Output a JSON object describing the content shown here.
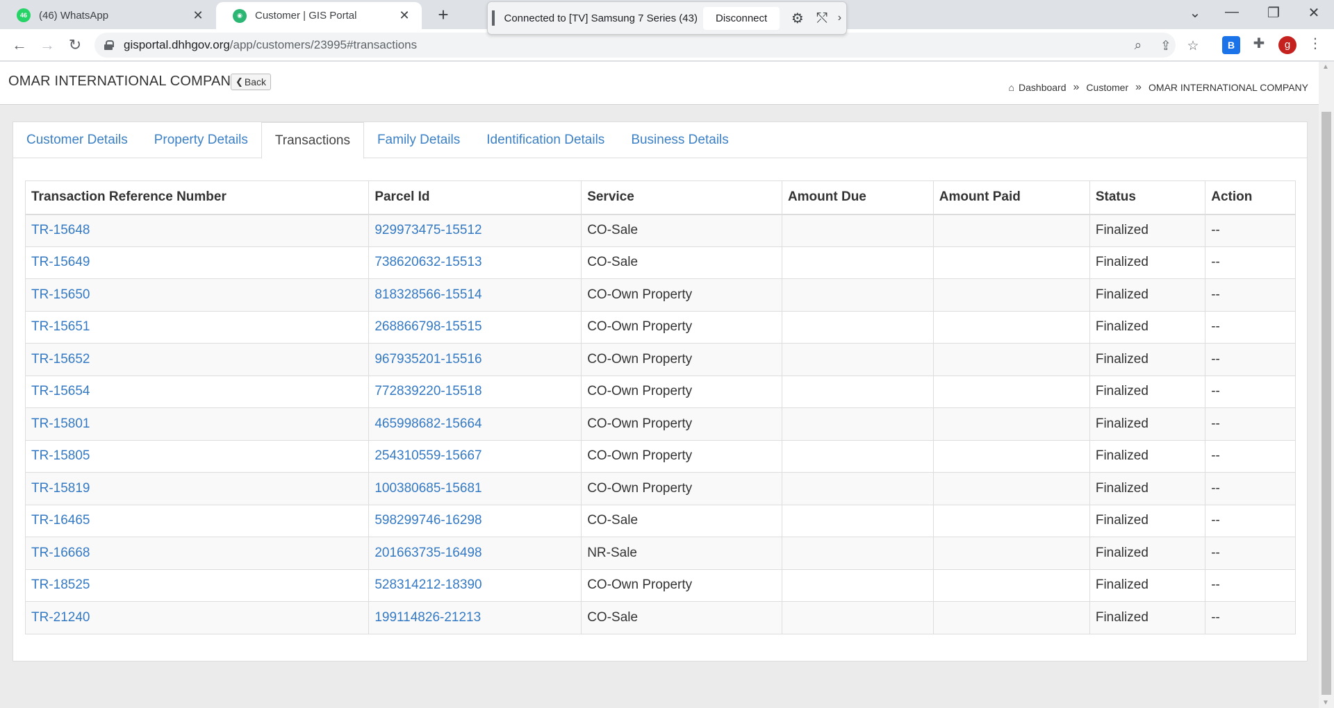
{
  "browser": {
    "tabs": [
      {
        "favicon": "whatsapp-icon",
        "badge": "46",
        "title": "(46) WhatsApp",
        "active": false
      },
      {
        "favicon": "gis-portal-icon",
        "title": "Customer | GIS Portal",
        "active": true
      }
    ],
    "cast": {
      "text": "Connected to [TV] Samsung 7 Series (43)",
      "disconnect_label": "Disconnect"
    },
    "url": {
      "host": "gisportal.dhhgov.org",
      "path": "/app/customers/23995#transactions"
    },
    "profile_initial": "g"
  },
  "page": {
    "company_name": "OMAR INTERNATIONAL COMPANY",
    "back_label": "Back",
    "breadcrumb": [
      "Dashboard",
      "Customer",
      "OMAR INTERNATIONAL COMPANY"
    ],
    "breadcrumb_sep": "»",
    "tabs": [
      {
        "label": "Customer Details",
        "active": false
      },
      {
        "label": "Property Details",
        "active": false
      },
      {
        "label": "Transactions",
        "active": true
      },
      {
        "label": "Family Details",
        "active": false
      },
      {
        "label": "Identification Details",
        "active": false
      },
      {
        "label": "Business Details",
        "active": false
      }
    ],
    "table": {
      "headers": [
        "Transaction Reference Number",
        "Parcel Id",
        "Service",
        "Amount Due",
        "Amount Paid",
        "Status",
        "Action"
      ],
      "rows": [
        {
          "ref": "TR-15648",
          "parcel": "929973475-15512",
          "service": "CO-Sale",
          "due": "",
          "paid": "",
          "status": "Finalized",
          "action": "--"
        },
        {
          "ref": "TR-15649",
          "parcel": "738620632-15513",
          "service": "CO-Sale",
          "due": "",
          "paid": "",
          "status": "Finalized",
          "action": "--"
        },
        {
          "ref": "TR-15650",
          "parcel": "818328566-15514",
          "service": "CO-Own Property",
          "due": "",
          "paid": "",
          "status": "Finalized",
          "action": "--"
        },
        {
          "ref": "TR-15651",
          "parcel": "268866798-15515",
          "service": "CO-Own Property",
          "due": "",
          "paid": "",
          "status": "Finalized",
          "action": "--"
        },
        {
          "ref": "TR-15652",
          "parcel": "967935201-15516",
          "service": "CO-Own Property",
          "due": "",
          "paid": "",
          "status": "Finalized",
          "action": "--"
        },
        {
          "ref": "TR-15654",
          "parcel": "772839220-15518",
          "service": "CO-Own Property",
          "due": "",
          "paid": "",
          "status": "Finalized",
          "action": "--"
        },
        {
          "ref": "TR-15801",
          "parcel": "465998682-15664",
          "service": "CO-Own Property",
          "due": "",
          "paid": "",
          "status": "Finalized",
          "action": "--"
        },
        {
          "ref": "TR-15805",
          "parcel": "254310559-15667",
          "service": "CO-Own Property",
          "due": "",
          "paid": "",
          "status": "Finalized",
          "action": "--"
        },
        {
          "ref": "TR-15819",
          "parcel": "100380685-15681",
          "service": "CO-Own Property",
          "due": "",
          "paid": "",
          "status": "Finalized",
          "action": "--"
        },
        {
          "ref": "TR-16465",
          "parcel": "598299746-16298",
          "service": "CO-Sale",
          "due": "",
          "paid": "",
          "status": "Finalized",
          "action": "--"
        },
        {
          "ref": "TR-16668",
          "parcel": "201663735-16498",
          "service": "NR-Sale",
          "due": "",
          "paid": "",
          "status": "Finalized",
          "action": "--"
        },
        {
          "ref": "TR-18525",
          "parcel": "528314212-18390",
          "service": "CO-Own Property",
          "due": "",
          "paid": "",
          "status": "Finalized",
          "action": "--"
        },
        {
          "ref": "TR-21240",
          "parcel": "199114826-21213",
          "service": "CO-Sale",
          "due": "",
          "paid": "",
          "status": "Finalized",
          "action": "--"
        }
      ]
    }
  },
  "colors": {
    "link": "#3479c4",
    "tab_link": "#3c80c6",
    "page_bg": "#ebebeb"
  }
}
